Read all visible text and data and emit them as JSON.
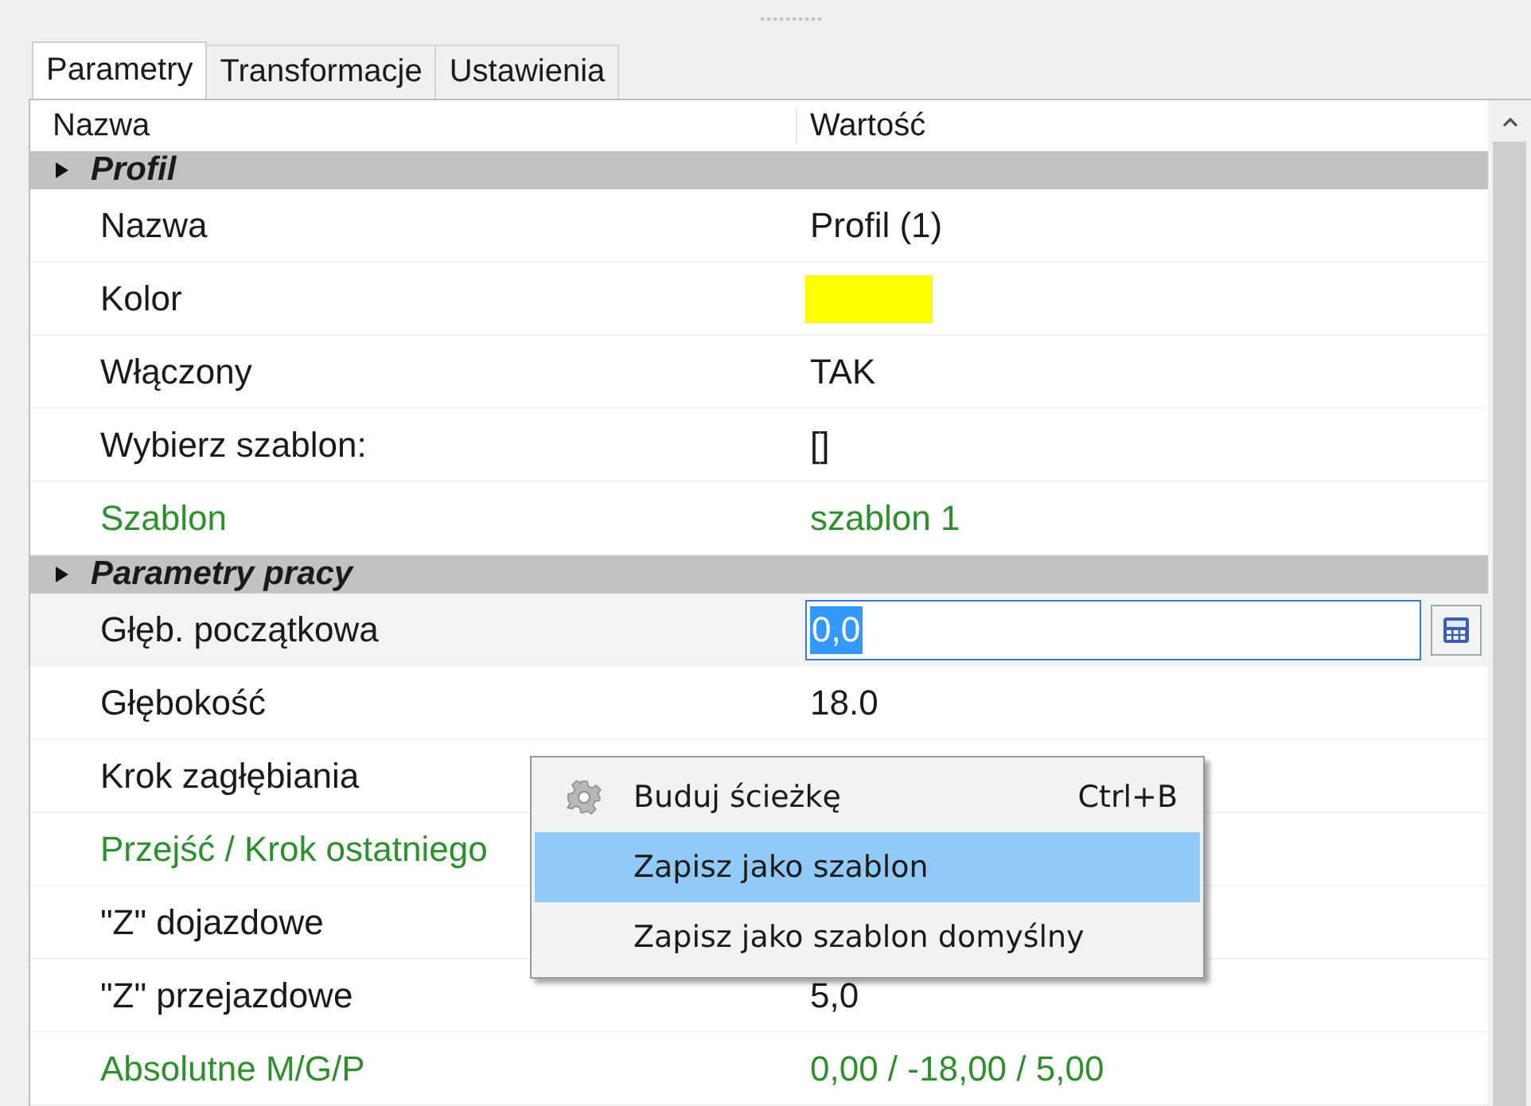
{
  "tabs": [
    {
      "label": "Parametry",
      "selected": true
    },
    {
      "label": "Transformacje",
      "selected": false
    },
    {
      "label": "Ustawienia",
      "selected": false
    }
  ],
  "grid": {
    "columns": [
      "Nazwa",
      "Wartość"
    ],
    "groups": [
      {
        "title": "Profil",
        "expanded": true,
        "rows": [
          {
            "name": "Nazwa",
            "kind": "text",
            "value": "Profil (1)",
            "color": "#1a1a1a",
            "selected": false
          },
          {
            "name": "Kolor",
            "kind": "swatch",
            "swatch": {
              "color": "#ffff00"
            },
            "color": "#1a1a1a",
            "selected": false
          },
          {
            "name": "Włączony",
            "kind": "text",
            "value": "TAK",
            "color": "#1a1a1a",
            "selected": false
          },
          {
            "name": "Wybierz szablon:",
            "kind": "text",
            "value": "[]",
            "color": "#1a1a1a",
            "selected": false
          },
          {
            "name": "Szablon",
            "kind": "text",
            "value": "szablon 1",
            "color": "#2f8f2f",
            "selected": false
          }
        ]
      },
      {
        "title": "Parametry pracy",
        "expanded": true,
        "rows": [
          {
            "name": "Głęb. początkowa",
            "kind": "editing",
            "value": "0,0",
            "color": "#1a1a1a",
            "selected": true
          },
          {
            "name": "Głębokość",
            "kind": "text",
            "value": "18.0",
            "color": "#1a1a1a",
            "selected": false
          },
          {
            "name": "Krok zagłębiania",
            "kind": "text",
            "color": "#1a1a1a",
            "selected": false
          },
          {
            "name": "Przejść / Krok ostatniego",
            "kind": "text",
            "color": "#2f8f2f",
            "selected": false
          },
          {
            "name": "\"Z\" dojazdowe",
            "kind": "text",
            "color": "#1a1a1a",
            "selected": false
          },
          {
            "name": "\"Z\" przejazdowe",
            "kind": "text",
            "value": "5,0",
            "color": "#1a1a1a",
            "selected": false
          },
          {
            "name": "Absolutne M/G/P",
            "kind": "text",
            "value": "0,00 / -18,00 / 5,00",
            "color": "#2f8f2f",
            "selected": false
          }
        ]
      }
    ]
  },
  "context_menu": {
    "items": [
      {
        "label": "Buduj ścieżkę",
        "shortcut": "Ctrl+B",
        "icon": true,
        "selected": false
      },
      {
        "label": "Zapisz jako szablon",
        "icon": false,
        "selected": true
      },
      {
        "label": "Zapisz jako szablon domyślny",
        "icon": false,
        "selected": false
      }
    ]
  }
}
